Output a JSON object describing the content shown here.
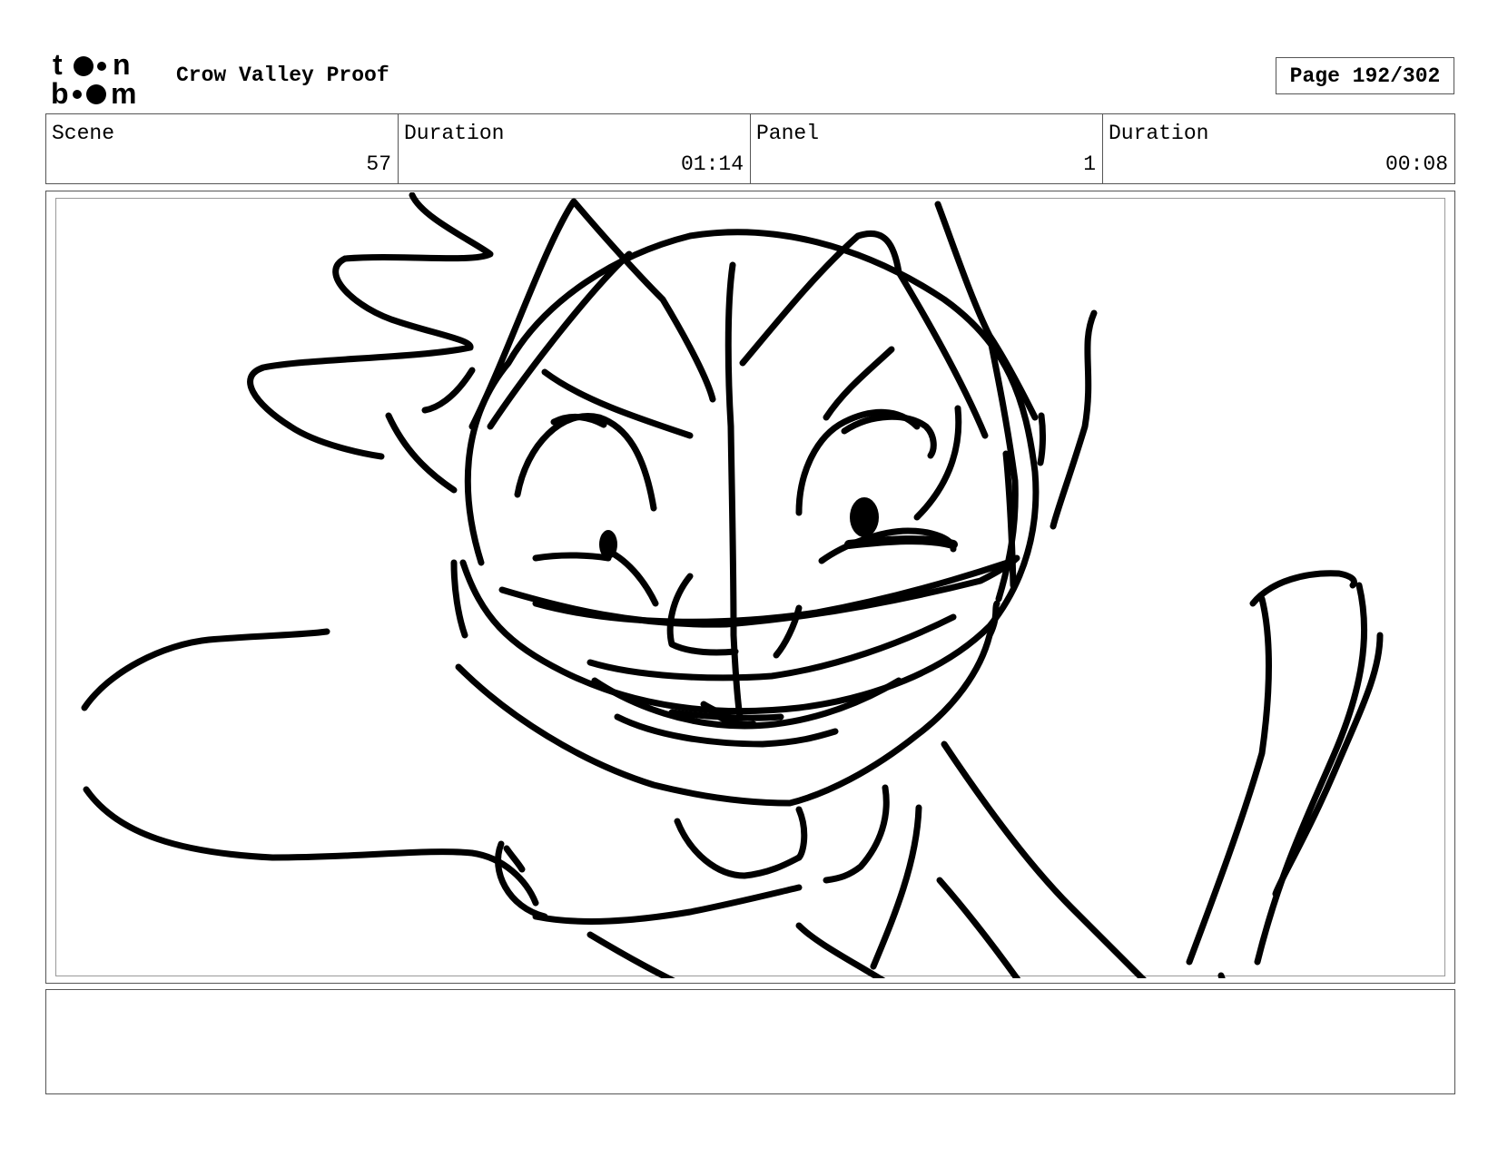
{
  "header": {
    "logo_text": "toon boom",
    "project_title": "Crow Valley Proof",
    "page_label": "Page 192/302"
  },
  "info": {
    "scene_label": "Scene",
    "scene_value": "57",
    "scene_duration_label": "Duration",
    "scene_duration_value": "01:14",
    "panel_label": "Panel",
    "panel_value": "1",
    "panel_duration_label": "Duration",
    "panel_duration_value": "00:08"
  },
  "notes": {
    "text": ""
  }
}
